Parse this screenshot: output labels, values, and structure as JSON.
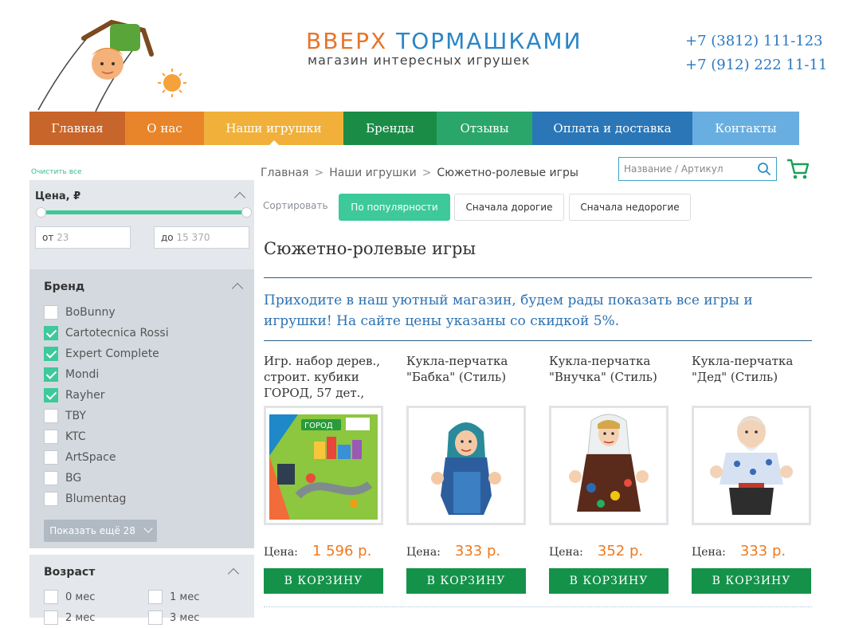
{
  "brand": {
    "title_part1": "ВВЕРХ",
    "title_part2": "ТОРМАШКАМИ",
    "subtitle": "магазин интересных игрушек"
  },
  "phones": [
    "+7 (3812) 111-123",
    "+7 (912) 222 11-11"
  ],
  "nav": [
    {
      "label": "Главная",
      "color": "#c8652a"
    },
    {
      "label": "О нас",
      "color": "#e8852a"
    },
    {
      "label": "Наши игрушки",
      "color": "#f0b03a",
      "active": true
    },
    {
      "label": "Бренды",
      "color": "#1a8c46"
    },
    {
      "label": "Отзывы",
      "color": "#2aa66a"
    },
    {
      "label": "Оплата и доставка",
      "color": "#2a76b6"
    },
    {
      "label": "Контакты",
      "color": "#68aee0"
    }
  ],
  "sidebar": {
    "clear_all": "Очистить все",
    "price": {
      "title": "Цена, ₽",
      "from_prefix": "от",
      "from_value": "23",
      "to_prefix": "до",
      "to_value": "15 370"
    },
    "brand_filter": {
      "title": "Бренд",
      "items": [
        {
          "label": "BoBunny",
          "checked": false
        },
        {
          "label": "Cartotecnica Rossi",
          "checked": true
        },
        {
          "label": "Expert Complete",
          "checked": true
        },
        {
          "label": "Mondi",
          "checked": true
        },
        {
          "label": "Rayher",
          "checked": true
        },
        {
          "label": "TBY",
          "checked": false
        },
        {
          "label": "KTC",
          "checked": false
        },
        {
          "label": "ArtSpace",
          "checked": false
        },
        {
          "label": "BG",
          "checked": false
        },
        {
          "label": "Blumentag",
          "checked": false
        }
      ],
      "show_more": "Показать ещё 28"
    },
    "age_filter": {
      "title": "Возраст",
      "items": [
        {
          "label": "0 мес",
          "checked": false
        },
        {
          "label": "1 мес",
          "checked": false
        },
        {
          "label": "2 мес",
          "checked": false
        },
        {
          "label": "3 мес",
          "checked": false
        }
      ]
    }
  },
  "breadcrumb": [
    "Главная",
    "Наши игрушки",
    "Сюжетно-ролевые игры"
  ],
  "search": {
    "placeholder": "Название / Артикул"
  },
  "sort": {
    "label": "Сортировать",
    "options": [
      {
        "label": "По популярности",
        "active": true
      },
      {
        "label": "Сначала дорогие",
        "active": false
      },
      {
        "label": "Сначала недорогие",
        "active": false
      }
    ]
  },
  "page_title": "Сюжетно-ролевые игры",
  "intro": "Приходите в наш уютный магазин, будем рады показать все игры и игрушки! На сайте цены указаны со скидкой 5%.",
  "products": [
    {
      "name": "Игр. набор дерев., строит. кубики ГОРОД, 57 дет.,",
      "price_label": "Цена:",
      "price": "1 596 р.",
      "button": "В КОРЗИНУ",
      "image": "wooden-blocks-box-image"
    },
    {
      "name": "Кукла-перчатка \"Бабка\" (Стиль)",
      "price_label": "Цена:",
      "price": "333 р.",
      "button": "В КОРЗИНУ",
      "image": "glove-puppet-grandma-image"
    },
    {
      "name": "Кукла-перчатка \"Внучка\" (Стиль)",
      "price_label": "Цена:",
      "price": "352 р.",
      "button": "В КОРЗИНУ",
      "image": "glove-puppet-granddaughter-image"
    },
    {
      "name": "Кукла-перчатка \"Дед\" (Стиль)",
      "price_label": "Цена:",
      "price": "333 р.",
      "button": "В КОРЗИНУ",
      "image": "glove-puppet-grandpa-image"
    }
  ]
}
